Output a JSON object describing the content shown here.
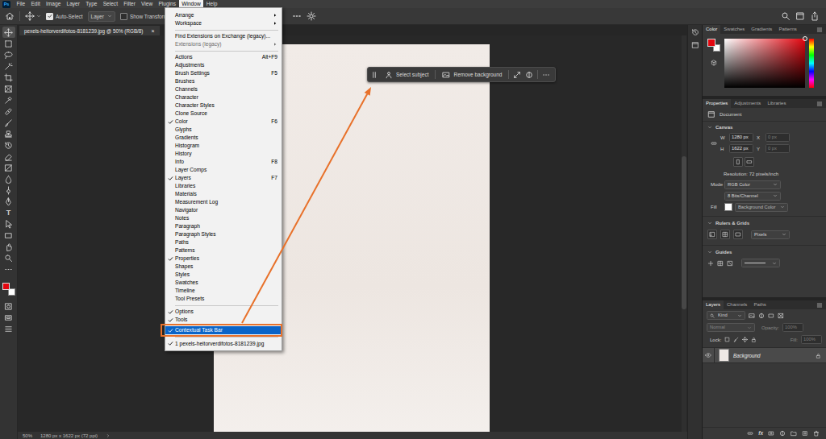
{
  "app": {
    "logo": "Ps"
  },
  "menubar": [
    {
      "label": "File",
      "selected": false
    },
    {
      "label": "Edit",
      "selected": false
    },
    {
      "label": "Image",
      "selected": false
    },
    {
      "label": "Layer",
      "selected": false
    },
    {
      "label": "Type",
      "selected": false
    },
    {
      "label": "Select",
      "selected": false
    },
    {
      "label": "Filter",
      "selected": false
    },
    {
      "label": "View",
      "selected": false
    },
    {
      "label": "Plugins",
      "selected": false
    },
    {
      "label": "Window",
      "selected": true
    },
    {
      "label": "Help",
      "selected": false
    }
  ],
  "options_bar": {
    "auto_select": {
      "label": "Auto-Select",
      "checked": true
    },
    "target": "Layer",
    "transform": {
      "label": "Show Transform Contr",
      "checked": false
    }
  },
  "document_tab": {
    "title": "pexels-heitorverdifotos-8181239.jpg @ 50% (RGB/8)",
    "close": "×",
    "selected": true
  },
  "tools": [
    {
      "kind": "move",
      "selected": true
    },
    {
      "kind": "marquee",
      "selected": false
    },
    {
      "kind": "lasso",
      "selected": false
    },
    {
      "kind": "quick-select",
      "selected": false
    },
    {
      "kind": "crop",
      "selected": false
    },
    {
      "kind": "frame",
      "selected": false
    },
    {
      "kind": "eyedropper",
      "selected": false
    },
    {
      "kind": "healing",
      "selected": false
    },
    {
      "kind": "brush",
      "selected": false
    },
    {
      "kind": "stamp",
      "selected": false
    },
    {
      "kind": "history",
      "selected": false
    },
    {
      "kind": "eraser",
      "selected": false
    },
    {
      "kind": "gradient",
      "selected": false
    },
    {
      "kind": "blur",
      "selected": false
    },
    {
      "kind": "dodge",
      "selected": false
    },
    {
      "kind": "pen",
      "selected": false
    },
    {
      "kind": "type",
      "glyph": "T",
      "selected": false
    },
    {
      "kind": "path-select",
      "selected": false
    },
    {
      "kind": "shape",
      "selected": false
    },
    {
      "kind": "hand",
      "selected": false
    },
    {
      "kind": "zoom",
      "selected": false
    },
    {
      "kind": "more",
      "selected": false
    }
  ],
  "tools_bottom": [
    {
      "kind": "quick-mask",
      "selected": false
    },
    {
      "kind": "screen-mode",
      "selected": false
    },
    {
      "kind": "edit-toolbar",
      "selected": false
    }
  ],
  "color_swatches": [
    {
      "color": "#e3060f"
    },
    {
      "color": "#ffffff"
    }
  ],
  "window_menu": {
    "groups": [
      [
        {
          "label": "Arrange",
          "shortcut": "",
          "checked": false,
          "submenu": true,
          "disabled": false,
          "selected": false
        },
        {
          "label": "Workspace",
          "shortcut": "",
          "checked": false,
          "submenu": true,
          "disabled": false,
          "selected": false
        }
      ],
      [
        {
          "label": "Find Extensions on Exchange (legacy)...",
          "shortcut": "",
          "checked": false,
          "submenu": false,
          "disabled": false,
          "selected": false
        },
        {
          "label": "Extensions (legacy)",
          "shortcut": "",
          "checked": false,
          "submenu": true,
          "disabled": true,
          "selected": false
        }
      ],
      [
        {
          "label": "Actions",
          "shortcut": "Alt+F9",
          "checked": false,
          "submenu": false,
          "disabled": false,
          "selected": false
        },
        {
          "label": "Adjustments",
          "shortcut": "",
          "checked": false,
          "submenu": false,
          "disabled": false,
          "selected": false
        },
        {
          "label": "Brush Settings",
          "shortcut": "F5",
          "checked": false,
          "submenu": false,
          "disabled": false,
          "selected": false
        },
        {
          "label": "Brushes",
          "shortcut": "",
          "checked": false,
          "submenu": false,
          "disabled": false,
          "selected": false
        },
        {
          "label": "Channels",
          "shortcut": "",
          "checked": false,
          "submenu": false,
          "disabled": false,
          "selected": false
        },
        {
          "label": "Character",
          "shortcut": "",
          "checked": false,
          "submenu": false,
          "disabled": false,
          "selected": false
        },
        {
          "label": "Character Styles",
          "shortcut": "",
          "checked": false,
          "submenu": false,
          "disabled": false,
          "selected": false
        },
        {
          "label": "Clone Source",
          "shortcut": "",
          "checked": false,
          "submenu": false,
          "disabled": false,
          "selected": false
        },
        {
          "label": "Color",
          "shortcut": "F6",
          "checked": true,
          "submenu": false,
          "disabled": false,
          "selected": false
        },
        {
          "label": "Glyphs",
          "shortcut": "",
          "checked": false,
          "submenu": false,
          "disabled": false,
          "selected": false
        },
        {
          "label": "Gradients",
          "shortcut": "",
          "checked": false,
          "submenu": false,
          "disabled": false,
          "selected": false
        },
        {
          "label": "Histogram",
          "shortcut": "",
          "checked": false,
          "submenu": false,
          "disabled": false,
          "selected": false
        },
        {
          "label": "History",
          "shortcut": "",
          "checked": false,
          "submenu": false,
          "disabled": false,
          "selected": false
        },
        {
          "label": "Info",
          "shortcut": "F8",
          "checked": false,
          "submenu": false,
          "disabled": false,
          "selected": false
        },
        {
          "label": "Layer Comps",
          "shortcut": "",
          "checked": false,
          "submenu": false,
          "disabled": false,
          "selected": false
        },
        {
          "label": "Layers",
          "shortcut": "F7",
          "checked": true,
          "submenu": false,
          "disabled": false,
          "selected": false
        },
        {
          "label": "Libraries",
          "shortcut": "",
          "checked": false,
          "submenu": false,
          "disabled": false,
          "selected": false
        },
        {
          "label": "Materials",
          "shortcut": "",
          "checked": false,
          "submenu": false,
          "disabled": false,
          "selected": false
        },
        {
          "label": "Measurement Log",
          "shortcut": "",
          "checked": false,
          "submenu": false,
          "disabled": false,
          "selected": false
        },
        {
          "label": "Navigator",
          "shortcut": "",
          "checked": false,
          "submenu": false,
          "disabled": false,
          "selected": false
        },
        {
          "label": "Notes",
          "shortcut": "",
          "checked": false,
          "submenu": false,
          "disabled": false,
          "selected": false
        },
        {
          "label": "Paragraph",
          "shortcut": "",
          "checked": false,
          "submenu": false,
          "disabled": false,
          "selected": false
        },
        {
          "label": "Paragraph Styles",
          "shortcut": "",
          "checked": false,
          "submenu": false,
          "disabled": false,
          "selected": false
        },
        {
          "label": "Paths",
          "shortcut": "",
          "checked": false,
          "submenu": false,
          "disabled": false,
          "selected": false
        },
        {
          "label": "Patterns",
          "shortcut": "",
          "checked": false,
          "submenu": false,
          "disabled": false,
          "selected": false
        },
        {
          "label": "Properties",
          "shortcut": "",
          "checked": true,
          "submenu": false,
          "disabled": false,
          "selected": false
        },
        {
          "label": "Shapes",
          "shortcut": "",
          "checked": false,
          "submenu": false,
          "disabled": false,
          "selected": false
        },
        {
          "label": "Styles",
          "shortcut": "",
          "checked": false,
          "submenu": false,
          "disabled": false,
          "selected": false
        },
        {
          "label": "Swatches",
          "shortcut": "",
          "checked": false,
          "submenu": false,
          "disabled": false,
          "selected": false
        },
        {
          "label": "Timeline",
          "shortcut": "",
          "checked": false,
          "submenu": false,
          "disabled": false,
          "selected": false
        },
        {
          "label": "Tool Presets",
          "shortcut": "",
          "checked": false,
          "submenu": false,
          "disabled": false,
          "selected": false
        }
      ],
      [
        {
          "label": "Options",
          "shortcut": "",
          "checked": true,
          "submenu": false,
          "disabled": false,
          "selected": false
        },
        {
          "label": "Tools",
          "shortcut": "",
          "checked": true,
          "submenu": false,
          "disabled": false,
          "selected": false
        },
        {
          "label": "Contextual Task Bar",
          "shortcut": "",
          "checked": true,
          "submenu": false,
          "disabled": false,
          "selected": true
        }
      ],
      [
        {
          "label": "1 pexels-heitorverdifotos-8181239.jpg",
          "shortcut": "",
          "checked": true,
          "submenu": false,
          "disabled": false,
          "selected": false
        }
      ]
    ]
  },
  "task_bar": {
    "buttons": [
      {
        "label": "Select subject",
        "kind": "person"
      },
      {
        "label": "Remove background",
        "kind": "image"
      }
    ]
  },
  "color_panel": {
    "tabs": [
      {
        "label": "Color",
        "selected": true
      },
      {
        "label": "Swatches",
        "selected": false
      },
      {
        "label": "Gradients",
        "selected": false
      },
      {
        "label": "Patterns",
        "selected": false
      }
    ]
  },
  "properties": {
    "tabs": [
      {
        "label": "Properties",
        "selected": true
      },
      {
        "label": "Adjustments",
        "selected": false
      },
      {
        "label": "Libraries",
        "selected": false
      }
    ],
    "document": "Document",
    "canvas": {
      "title": "Canvas",
      "expanded": true,
      "fields": [
        {
          "label": "W",
          "value": "1280 px",
          "disabled": false
        },
        {
          "label": "X",
          "value": "0 px",
          "disabled": true
        },
        {
          "label": "H",
          "value": "1622 px",
          "disabled": false
        },
        {
          "label": "Y",
          "value": "0 px",
          "disabled": true
        }
      ],
      "resolution": "Resolution: 72 pixels/inch",
      "mode_label": "Mode",
      "mode": "RGB Color",
      "depth": "8 Bits/Channel",
      "fill_label": "Fill",
      "fill": "Background Color"
    },
    "rulers": {
      "title": "Rulers & Grids",
      "expanded": true,
      "unit": "Pixels"
    },
    "guides": {
      "title": "Guides",
      "expanded": true
    }
  },
  "layers": {
    "tabs": [
      {
        "label": "Layers",
        "selected": true
      },
      {
        "label": "Channels",
        "selected": false
      },
      {
        "label": "Paths",
        "selected": false
      }
    ],
    "filter": "Kind",
    "blend": "Normal",
    "opacity_label": "Opacity:",
    "opacity": "100%",
    "lock_label": "Lock:",
    "fill_label": "Fill:",
    "fill": "100%",
    "controls_disabled": true,
    "items": [
      {
        "name": "Background",
        "visible": true,
        "locked": true,
        "selected": true
      }
    ],
    "footer_fx": "fx"
  },
  "status_bar": {
    "zoom": "50%",
    "info": "1280 px x 1622 px (72 ppi)"
  }
}
